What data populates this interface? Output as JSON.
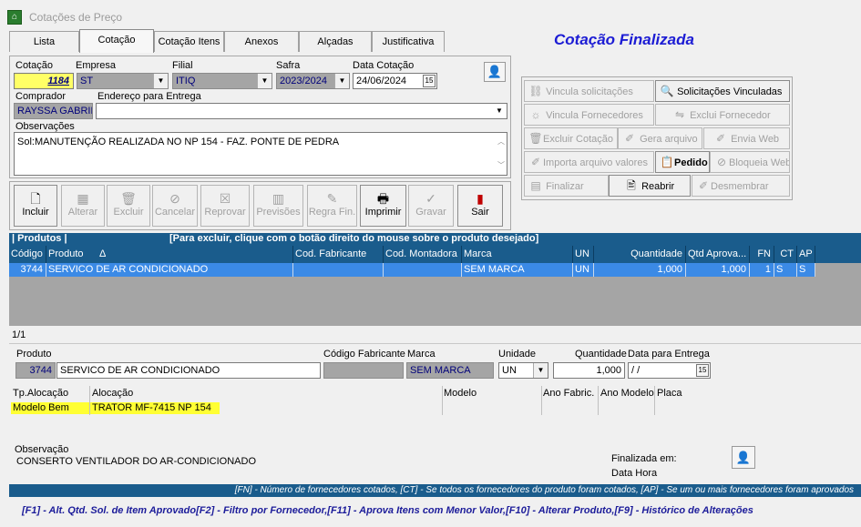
{
  "window": {
    "title": "Cotações de Preço"
  },
  "tabs": [
    {
      "label": "Lista"
    },
    {
      "label": "Cotação"
    },
    {
      "label": "Cotação Itens"
    },
    {
      "label": "Anexos"
    },
    {
      "label": "Alçadas"
    },
    {
      "label": "Justificativa"
    }
  ],
  "status_heading": "Cotação Finalizada",
  "form": {
    "cotacao_label": "Cotação",
    "cotacao_value": "1184",
    "empresa_label": "Empresa",
    "empresa_value": "ST",
    "filial_label": "Filial",
    "filial_value": "ITIQ",
    "safra_label": "Safra",
    "safra_value": "2023/2024",
    "data_label": "Data Cotação",
    "data_value": "24/06/2024",
    "comprador_label": "Comprador",
    "comprador_value": "RAYSSA GABRIE",
    "endereco_label": "Endereço para Entrega",
    "endereco_value": "",
    "obs_label": "Observações",
    "obs_value": "Sol:MANUTENÇÃO REALIZADA NO NP 154  - FAZ. PONTE DE PEDRA"
  },
  "toolbar": [
    {
      "label": "Incluir",
      "icon": "file-icon",
      "enabled": true
    },
    {
      "label": "Alterar",
      "icon": "edit-icon",
      "enabled": false
    },
    {
      "label": "Excluir",
      "icon": "trash-icon",
      "enabled": false
    },
    {
      "label": "Cancelar",
      "icon": "cancel-icon",
      "enabled": false
    },
    {
      "label": "Reprovar",
      "icon": "reject-icon",
      "enabled": false
    },
    {
      "label": "Previsões",
      "icon": "forecast-icon",
      "enabled": false
    },
    {
      "label": "Regra Fin.",
      "icon": "rule-icon",
      "enabled": false
    },
    {
      "label": "Imprimir",
      "icon": "printer-icon",
      "enabled": true
    },
    {
      "label": "Gravar",
      "icon": "check-icon",
      "enabled": false
    },
    {
      "label": "Sair",
      "icon": "exit-icon",
      "enabled": true
    }
  ],
  "actions": {
    "vincula_solicitacoes": "Vincula solicitações",
    "solicitacoes_vinculadas": "Solicitações Vinculadas",
    "vincula_fornecedores": "Vincula Fornecedores",
    "exclui_fornecedor": "Exclui Fornecedor",
    "excluir_cotacao": "Excluir Cotação",
    "gera_arquivo": "Gera arquivo",
    "envia_web": "Envia Web",
    "importa_arquivo": "Importa arquivo valores",
    "pedido": "Pedido",
    "bloqueia_web": "Bloqueia Web",
    "finalizar": "Finalizar",
    "reabrir": "Reabrir",
    "desmembrar": "Desmembrar"
  },
  "products": {
    "section_label": "| Produtos |",
    "hint": "[Para excluir, clique com o botão direito do mouse sobre o produto desejado]",
    "columns": [
      "Código",
      "Produto",
      "Cod. Fabricante",
      "Cod. Montadora",
      "Marca",
      "UN",
      "Quantidade",
      "Qtd Aprova...",
      "FN",
      "CT",
      "AP"
    ],
    "sort_indicator": "Δ",
    "rows": [
      {
        "codigo": "3744",
        "produto": "SERVICO DE AR CONDICIONADO",
        "cod_fab": "",
        "cod_mont": "",
        "marca": "SEM MARCA",
        "un": "UN",
        "quantidade": "1,000",
        "qtd_aprov": "1,000",
        "fn": "1",
        "ct": "S",
        "ap": "S"
      }
    ],
    "pager": "1/1"
  },
  "detail": {
    "produto_label": "Produto",
    "produto_code": "3744",
    "produto_name": "SERVICO DE AR CONDICIONADO",
    "cod_fab_label": "Código Fabricante",
    "cod_fab_value": "",
    "marca_label": "Marca",
    "marca_value": "SEM MARCA",
    "unidade_label": "Unidade",
    "unidade_value": "UN",
    "quantidade_label": "Quantidade",
    "quantidade_value": "1,000",
    "data_entrega_label": "Data para Entrega",
    "data_entrega_value": " / /",
    "alloc_headers": {
      "tp": "Tp.Alocação",
      "alocacao": "Alocação",
      "modelo": "Modelo",
      "ano_fab": "Ano Fabric.",
      "ano_mod": "Ano Modelo",
      "placa": "Placa"
    },
    "alloc_row": {
      "tp": "Modelo Bem",
      "alocacao": "TRATOR MF-7415 NP 154"
    },
    "obs_label": "Observação",
    "obs_value": "CONSERTO VENTILADOR DO AR-CONDICIONADO",
    "finalizada_label": "Finalizada em:",
    "data_hora_label": "Data Hora"
  },
  "legend": "[FN] - Número de fornecedores cotados, [CT] - Se todos os fornecedores do produto foram cotados, [AP] - Se um ou mais fornecedores foram aprovados",
  "shortcuts": "[F1] - Alt. Qtd. Sol. de Item Aprovado[F2] - Filtro por Fornecedor,[F11] - Aprova Itens com Menor Valor,[F10] - Alterar Produto,[F9] - Histórico de Alterações"
}
